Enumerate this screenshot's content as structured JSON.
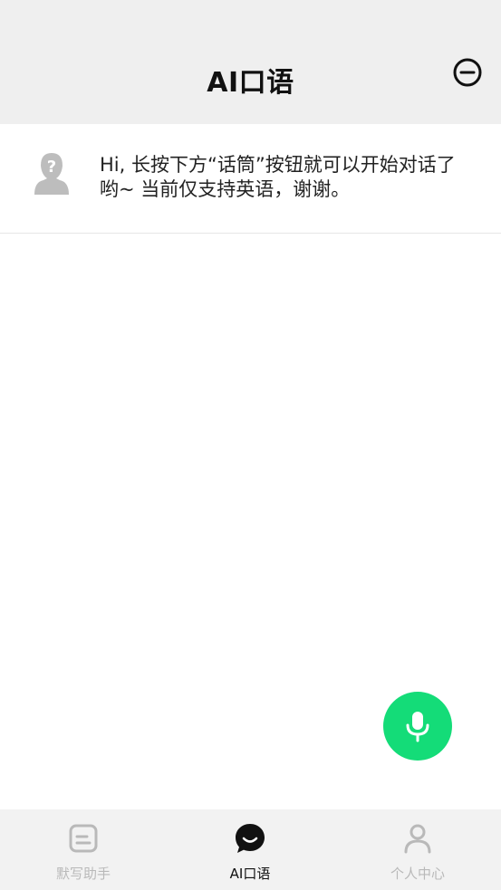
{
  "header": {
    "title": "AI口语",
    "action_icon": "minus-circle-icon"
  },
  "message": {
    "avatar_icon": "unknown-user-icon",
    "text": "Hi, 长按下方“话筒”按钮就可以开始对话了哟~ 当前仅支持英语，谢谢。"
  },
  "mic": {
    "icon": "microphone-icon",
    "color": "#14dc78"
  },
  "tabs": [
    {
      "label": "默写助手",
      "icon": "note-icon",
      "active": false
    },
    {
      "label": "AI口语",
      "icon": "chat-bubble-icon",
      "active": true
    },
    {
      "label": "个人中心",
      "icon": "user-icon",
      "active": false
    }
  ],
  "colors": {
    "header_bg": "#efefef",
    "tabbar_bg": "#f2f2f2",
    "inactive_tab": "#b9b9b9",
    "active_tab": "#111111"
  }
}
